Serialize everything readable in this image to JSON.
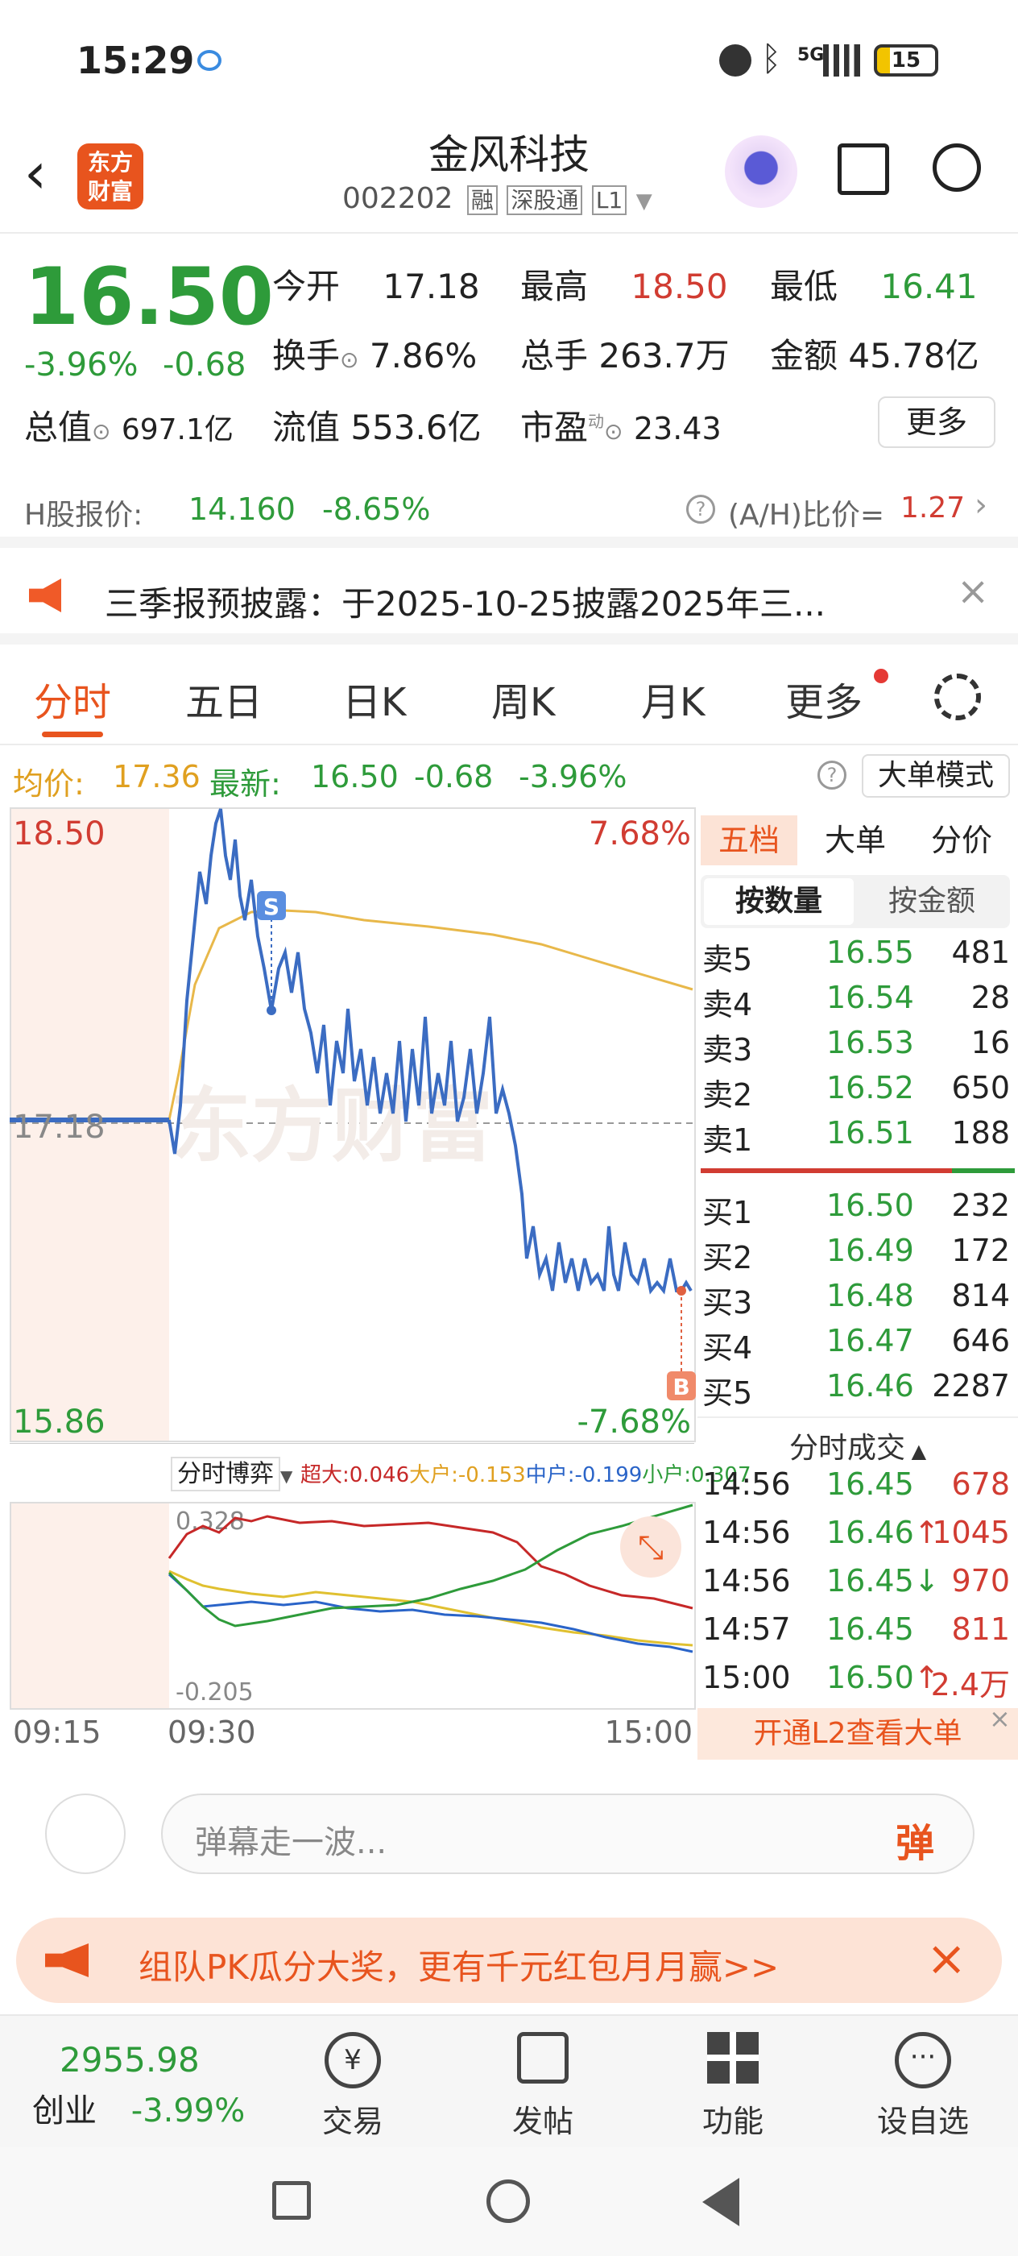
{
  "status": {
    "time": "15:29",
    "battery": "15",
    "network": "5G"
  },
  "header": {
    "name": "金风科技",
    "code": "002202",
    "tags": [
      "融",
      "深股通",
      "L1"
    ],
    "logo_line1": "东方",
    "logo_line2": "财富"
  },
  "quote": {
    "price": "16.50",
    "change_pct": "-3.96%",
    "change": "-0.68",
    "open_label": "今开",
    "open": "17.18",
    "high_label": "最高",
    "high": "18.50",
    "low_label": "最低",
    "low": "16.41",
    "turnover_label": "换手",
    "turnover": "7.86%",
    "volume_label": "总手",
    "volume": "263.7万",
    "amount_label": "金额",
    "amount": "45.78亿",
    "mcap_label": "总值",
    "mcap": "697.1亿",
    "float_label": "流值",
    "float": "553.6亿",
    "pe_label": "市盈",
    "pe_sup": "动",
    "pe": "23.43",
    "more": "更多"
  },
  "hshare": {
    "label": "H股报价:",
    "price": "14.160",
    "pct": "-8.65%",
    "ah_label": "(A/H)比价=",
    "ah": "1.27"
  },
  "notice": {
    "text": "三季报预披露：于2025-10-25披露2025年三..."
  },
  "tabs": [
    "分时",
    "五日",
    "日K",
    "周K",
    "月K",
    "更多"
  ],
  "subinfo": {
    "avg_label": "均价:",
    "avg": "17.36",
    "latest_label": "最新:",
    "latest": "16.50",
    "chg": "-0.68",
    "pct": "-3.96%",
    "mode": "大单模式"
  },
  "chart": {
    "y_high": "18.50",
    "y_low": "15.86",
    "pct_high": "7.68%",
    "pct_low": "-7.68%",
    "ref": "17.18",
    "watermark": "东方财富",
    "marker_s": "S",
    "marker_b": "B"
  },
  "flow": {
    "selector": "分时博弈",
    "labels": [
      "超大:0.046",
      "大户:-0.153",
      "中户:-0.199",
      "小户:0.307"
    ],
    "ymax": "0.328",
    "ymin": "-0.205",
    "t_start": "09:15",
    "t_mid": "09:30",
    "t_end": "15:00"
  },
  "side": {
    "tabs": [
      "五档",
      "大单",
      "分价"
    ],
    "subtabs": [
      "按数量",
      "按金额"
    ],
    "asks": [
      {
        "l": "卖5",
        "p": "16.55",
        "v": "481"
      },
      {
        "l": "卖4",
        "p": "16.54",
        "v": "28"
      },
      {
        "l": "卖3",
        "p": "16.53",
        "v": "16"
      },
      {
        "l": "卖2",
        "p": "16.52",
        "v": "650"
      },
      {
        "l": "卖1",
        "p": "16.51",
        "v": "188"
      }
    ],
    "bids": [
      {
        "l": "买1",
        "p": "16.50",
        "v": "232"
      },
      {
        "l": "买2",
        "p": "16.49",
        "v": "172"
      },
      {
        "l": "买3",
        "p": "16.48",
        "v": "814"
      },
      {
        "l": "买4",
        "p": "16.47",
        "v": "646"
      },
      {
        "l": "买5",
        "p": "16.46",
        "v": "2287"
      }
    ],
    "trades_title": "分时成交",
    "trades": [
      {
        "t": "14:56",
        "p": "16.45",
        "v": "678",
        "dir": ""
      },
      {
        "t": "14:56",
        "p": "16.46",
        "v": "1045",
        "dir": "↑"
      },
      {
        "t": "14:56",
        "p": "16.45",
        "v": "970",
        "dir": "↓"
      },
      {
        "t": "14:57",
        "p": "16.45",
        "v": "811",
        "dir": ""
      },
      {
        "t": "15:00",
        "p": "16.50",
        "v": "2.4万",
        "dir": "↑"
      }
    ],
    "l2": "开通L2查看大单"
  },
  "comment": {
    "placeholder": "弹幕走一波...",
    "danmu": "弹"
  },
  "promo": {
    "text": "组队PK瓜分大奖，更有千元红包月月赢>>"
  },
  "index": {
    "value": "2955.98",
    "name": "创业",
    "pct": "-3.99%"
  },
  "nav": [
    "交易",
    "发帖",
    "功能",
    "设自选"
  ]
}
